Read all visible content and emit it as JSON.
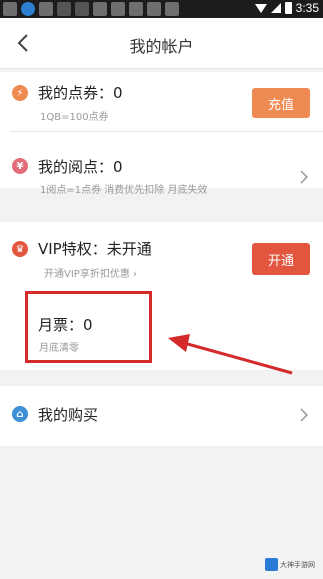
{
  "status_bar": {
    "time": "3:35"
  },
  "header": {
    "title": "我的帐户"
  },
  "coupons": {
    "label": "我的点券：0",
    "sub": "1QB=100点券",
    "button": "充值"
  },
  "readpoints": {
    "label": "我的阅点：0",
    "sub": "1阅点=1点券 消费优先扣除  月底失效"
  },
  "vip": {
    "label": "VIP特权：未开通",
    "sub": "开通VIP享折扣优惠 ›",
    "button": "开通"
  },
  "monthly_ticket": {
    "label": "月票：0",
    "sub": "月底清零"
  },
  "purchases": {
    "label": "我的购买"
  },
  "watermark": {
    "text": "大神手游网"
  },
  "colors": {
    "accent_orange": "#ef8a52",
    "accent_red": "#e2553e",
    "highlight_red": "#d42a2a"
  },
  "icons": {
    "coupon": "coin-icon",
    "readpoint": "yen-icon",
    "vip": "crown-icon",
    "purchase": "basket-icon"
  }
}
